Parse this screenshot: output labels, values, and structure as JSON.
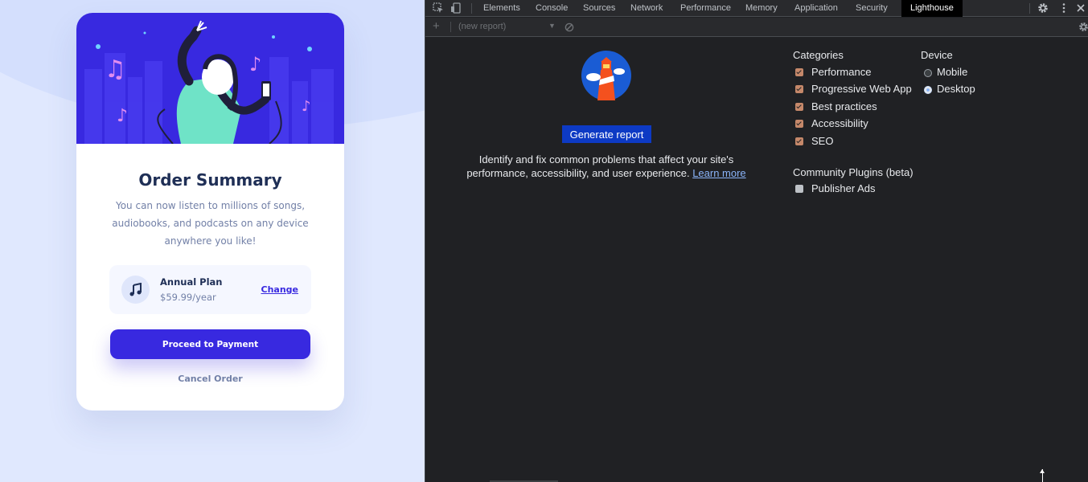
{
  "order": {
    "title": "Order Summary",
    "description": "You can now listen to millions of songs, audiobooks, and podcasts on any device anywhere you like!",
    "plan_name": "Annual Plan",
    "plan_price": "$59.99/year",
    "change_label": "Change",
    "pay_label": "Proceed to Payment",
    "cancel_label": "Cancel Order",
    "accent_color": "#3829e0"
  },
  "devtools": {
    "tabs": [
      "Elements",
      "Console",
      "Sources",
      "Network",
      "Performance",
      "Memory",
      "Application",
      "Security",
      "Lighthouse"
    ],
    "active_tab": "Lighthouse",
    "report_select": "(new report)",
    "generate_label": "Generate report",
    "description": "Identify and fix common problems that affect your site's performance, accessibility, and user experience.",
    "learn_more": "Learn more",
    "categories_title": "Categories",
    "categories": [
      {
        "label": "Performance",
        "checked": true
      },
      {
        "label": "Progressive Web App",
        "checked": true
      },
      {
        "label": "Best practices",
        "checked": true
      },
      {
        "label": "Accessibility",
        "checked": true
      },
      {
        "label": "SEO",
        "checked": true
      }
    ],
    "plugins_title": "Community Plugins (beta)",
    "plugins": [
      {
        "label": "Publisher Ads",
        "checked": false
      }
    ],
    "device_title": "Device",
    "devices": [
      {
        "label": "Mobile",
        "selected": false
      },
      {
        "label": "Desktop",
        "selected": true
      }
    ]
  }
}
